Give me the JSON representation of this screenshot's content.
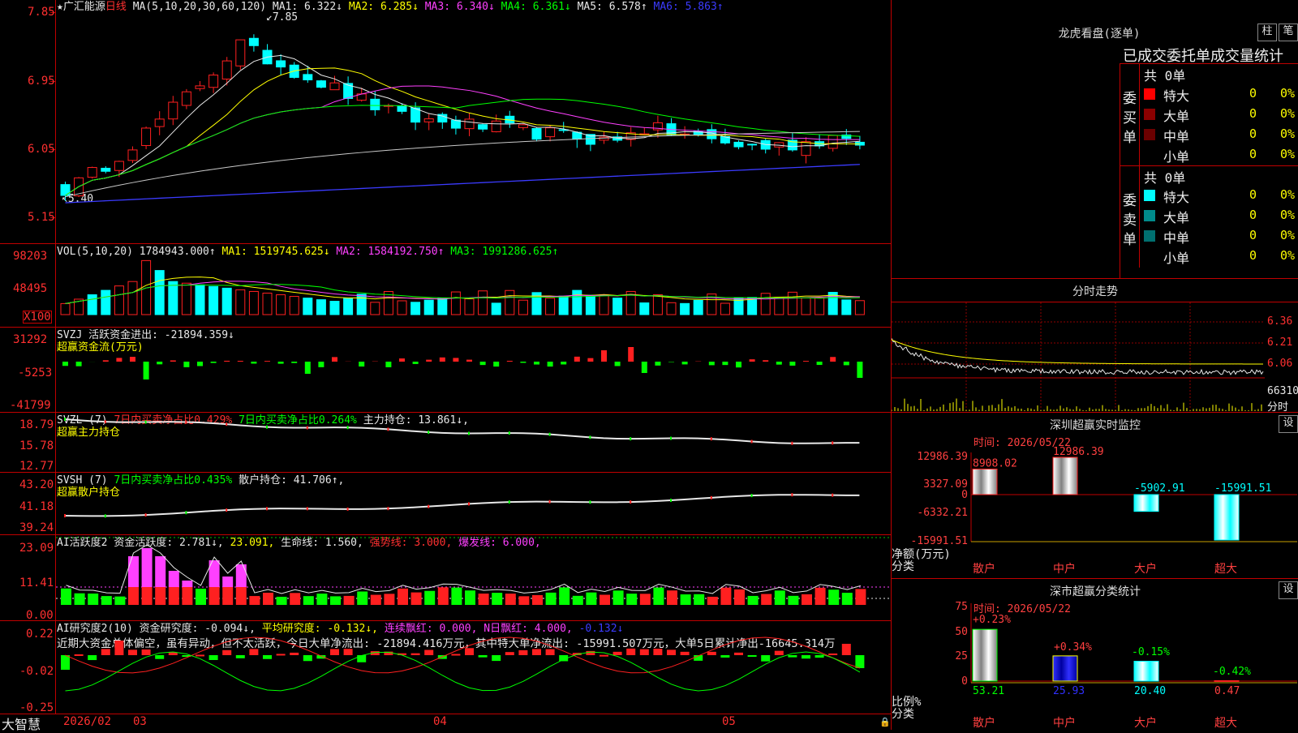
{
  "stock": {
    "name": "广汇能源",
    "period": "日线",
    "ma_label": "MA(5,10,20,30,60,120)",
    "ma1": "MA1: 6.322↓",
    "ma2": "MA2: 6.285↓",
    "ma3": "MA3: 6.340↓",
    "ma4": "MA4: 6.361↓",
    "ma5": "MA5: 6.578↑",
    "ma6": "MA6: 5.863↑",
    "high_mark": "7.85",
    "low_mark": "5.40",
    "price_axis": [
      "7.85",
      "6.95",
      "6.05",
      "5.15"
    ]
  },
  "vol": {
    "label": "VOL(5,10,20)",
    "value": "1784943.000↑",
    "ma1": "MA1: 1519745.625↓",
    "ma2": "MA2: 1584192.750↑",
    "ma3": "MA3: 1991286.625↑",
    "axis": [
      "98203",
      "48495"
    ],
    "unit": "X100"
  },
  "svzj": {
    "label": "SVZJ",
    "name": "活跃资金进出: -21894.359↓",
    "sub": "超赢资金流(万元)",
    "axis": [
      "31292",
      "-5253",
      "-41799"
    ]
  },
  "svzl": {
    "label": "SVZL (7)",
    "item1": "7日内买卖净占比0.429%",
    "item2": "7日内买卖净占比0.264%",
    "item3": "主力持仓: 13.861↓,",
    "sub": "超赢主力持仓",
    "axis": [
      "18.79",
      "15.78",
      "12.77"
    ]
  },
  "svsh": {
    "label": "SVSH (7)",
    "item1": "7日内买卖净占比0.435%",
    "item2": "散户持仓: 41.706↑,",
    "sub": "超赢散户持仓",
    "axis": [
      "43.20",
      "41.18",
      "39.24"
    ]
  },
  "ai_act": {
    "label": "AI活跃度2",
    "item1": "资金活跃度: 2.781↓,",
    "item2": "23.091,",
    "item3": "生命线: 1.560,",
    "item4": "强势线: 3.000,",
    "item5": "爆发线: 6.000,",
    "axis": [
      "23.09",
      "11.41",
      "0.00"
    ]
  },
  "ai_res": {
    "label": "AI研究度2(10)",
    "item1": "资金研究度: -0.094↓,",
    "item2": "平均研究度: -0.132↓,",
    "item3": "连续飘红: 0.000,",
    "item4": "N日飘红: 4.000,",
    "item5": "-0.132↓",
    "comment": "近期大资金总体偏空，虽有异动，但不太活跃，今日大单净流出: -21894.416万元，其中特大单净流出: -15991.507万元，大单5日累计净出-16645.314万",
    "axis": [
      "0.22",
      "-0.02",
      "-0.25"
    ]
  },
  "date_axis": {
    "logo": "大智慧",
    "labels": [
      "2026/02",
      "03",
      "04",
      "05"
    ]
  },
  "longhu": {
    "title": "龙虎看盘(逐单)",
    "btn1": "柱",
    "btn2": "笔",
    "header": "已成交委托单成交量统计",
    "buy_label": "委买单",
    "sell_label": "委卖单",
    "buy_total": "共 0单",
    "sell_total": "共 0单",
    "buy_rows": [
      {
        "label": "特大",
        "count": "0",
        "pct": "0%"
      },
      {
        "label": "大单",
        "count": "0",
        "pct": "0%"
      },
      {
        "label": "中单",
        "count": "0",
        "pct": "0%"
      },
      {
        "label": "小单",
        "count": "0",
        "pct": "0%"
      }
    ],
    "sell_rows": [
      {
        "label": "特大",
        "count": "0",
        "pct": "0%"
      },
      {
        "label": "大单",
        "count": "0",
        "pct": "0%"
      },
      {
        "label": "中单",
        "count": "0",
        "pct": "0%"
      },
      {
        "label": "小单",
        "count": "0",
        "pct": "0%"
      }
    ],
    "buy_colors": [
      "#ff0000",
      "#8b0000",
      "#6b0000",
      "#000000"
    ],
    "sell_colors": [
      "#00ffff",
      "#008b8b",
      "#007070",
      "#000000"
    ]
  },
  "intraday": {
    "title": "分时走势",
    "axis": [
      "6.36",
      "6.21",
      "6.06"
    ],
    "vol_label": "66310",
    "vol_sub": "分时"
  },
  "sz_monitor": {
    "title": "深圳超赢实时监控",
    "btn": "设",
    "time": "时间: 2026/05/22",
    "ylabel": "净额(万元)",
    "xlabel": "分类",
    "axis": [
      "12986.39",
      "3327.09",
      "0",
      "-6332.21",
      "-15991.51"
    ],
    "categories": [
      "散户",
      "中户",
      "大户",
      "超大"
    ],
    "values": [
      8908.02,
      12986.39,
      -5902.91,
      -15991.51
    ],
    "value_labels": [
      "8908.02",
      "12986.39",
      "-5902.91",
      "-15991.51"
    ]
  },
  "sz_classify": {
    "title": "深市超赢分类统计",
    "btn": "设",
    "time": "时间: 2026/05/22",
    "ylabel": "比例%",
    "xlabel": "分类",
    "axis": [
      "75",
      "50",
      "25",
      "0"
    ],
    "categories": [
      "散户",
      "中户",
      "大户",
      "超大"
    ],
    "values": [
      53.21,
      25.93,
      20.4,
      0.47
    ],
    "value_labels": [
      "53.21",
      "25.93",
      "20.40",
      "0.47"
    ],
    "pct_labels": [
      "+0.23%",
      "+0.34%",
      "-0.15%",
      "-0.42%"
    ]
  },
  "colors": {
    "up": "#ff2020",
    "down": "#00ffff",
    "green": "#00ff00",
    "grid": "#aa0000",
    "magenta": "#ff40ff"
  }
}
